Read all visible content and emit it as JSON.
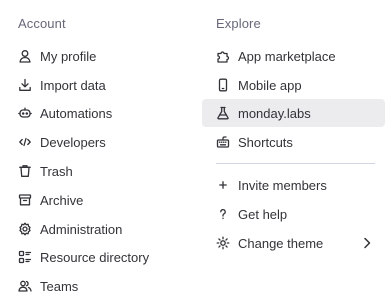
{
  "account": {
    "title": "Account",
    "items": [
      {
        "label": "My profile",
        "icon": "user-icon"
      },
      {
        "label": "Import data",
        "icon": "download-icon"
      },
      {
        "label": "Automations",
        "icon": "robot-icon"
      },
      {
        "label": "Developers",
        "icon": "code-icon"
      },
      {
        "label": "Trash",
        "icon": "trash-icon"
      },
      {
        "label": "Archive",
        "icon": "archive-icon"
      },
      {
        "label": "Administration",
        "icon": "gear-icon"
      },
      {
        "label": "Resource directory",
        "icon": "directory-icon"
      },
      {
        "label": "Teams",
        "icon": "team-icon"
      }
    ]
  },
  "explore": {
    "title": "Explore",
    "items": [
      {
        "label": "App marketplace",
        "icon": "puzzle-icon"
      },
      {
        "label": "Mobile app",
        "icon": "mobile-icon"
      },
      {
        "label": "monday.labs",
        "icon": "flask-icon",
        "active": true
      },
      {
        "label": "Shortcuts",
        "icon": "keyboard-icon"
      }
    ],
    "secondary_items": [
      {
        "label": "Invite members",
        "icon": "plus-icon"
      },
      {
        "label": "Get help",
        "icon": "question-icon"
      },
      {
        "label": "Change theme",
        "icon": "sun-icon",
        "has_submenu": true
      }
    ]
  },
  "colors": {
    "text": "#323338",
    "section_title": "#676879",
    "active_background": "#ececef",
    "divider": "#d0d4e4"
  }
}
